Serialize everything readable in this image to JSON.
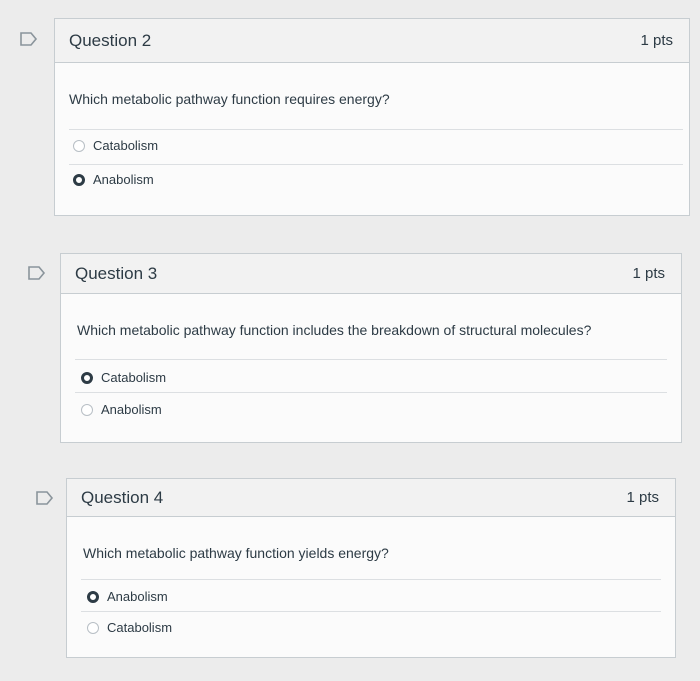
{
  "questions": [
    {
      "title": "Question 2",
      "points": "1 pts",
      "text": "Which metabolic pathway function requires energy?",
      "answers": [
        {
          "label": "Catabolism",
          "selected": false
        },
        {
          "label": "Anabolism",
          "selected": true
        }
      ]
    },
    {
      "title": "Question 3",
      "points": "1 pts",
      "text": "Which metabolic pathway function includes the breakdown of structural molecules?",
      "answers": [
        {
          "label": "Catabolism",
          "selected": true
        },
        {
          "label": "Anabolism",
          "selected": false
        }
      ]
    },
    {
      "title": "Question 4",
      "points": "1 pts",
      "text": "Which metabolic pathway function yields energy?",
      "answers": [
        {
          "label": "Anabolism",
          "selected": true
        },
        {
          "label": "Catabolism",
          "selected": false
        }
      ]
    }
  ],
  "icons": {
    "flag": "flag-question-icon"
  },
  "colors": {
    "text": "#2d3b45",
    "border": "#c7cdd1",
    "header_bg": "#f2f2f2"
  }
}
